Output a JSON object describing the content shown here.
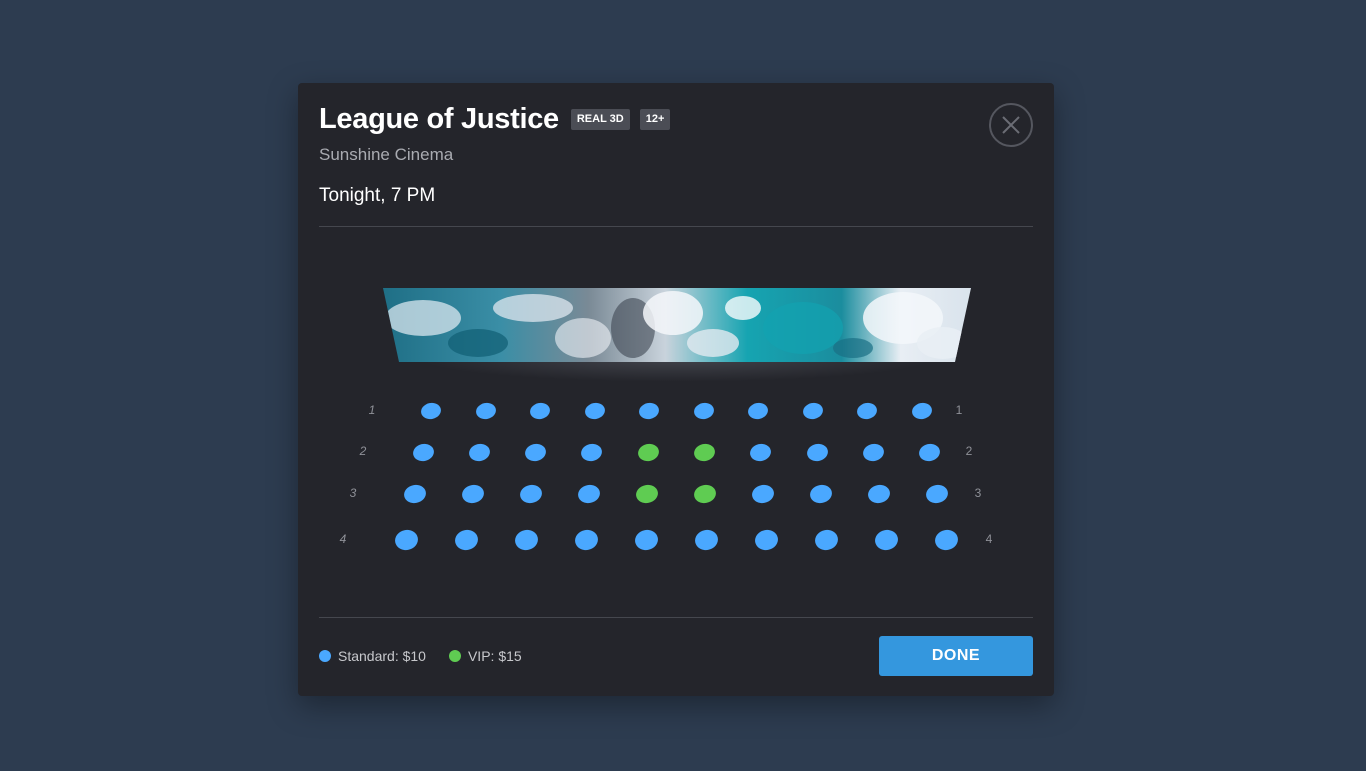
{
  "movie": {
    "title": "League of Justice",
    "badges": [
      "REAL 3D",
      "12+"
    ],
    "cinema": "Sunshine Cinema",
    "showtime": "Tonight, 7 PM"
  },
  "close_icon": "close-icon",
  "screen": {
    "image": "ocean-waves-aerial-photo"
  },
  "seating": {
    "rows": [
      {
        "label": "1",
        "seats": [
          "standard",
          "standard",
          "standard",
          "standard",
          "standard",
          "standard",
          "standard",
          "standard",
          "standard",
          "standard"
        ]
      },
      {
        "label": "2",
        "seats": [
          "standard",
          "standard",
          "standard",
          "standard",
          "vip",
          "vip",
          "standard",
          "standard",
          "standard",
          "standard"
        ]
      },
      {
        "label": "3",
        "seats": [
          "standard",
          "standard",
          "standard",
          "standard",
          "vip",
          "vip",
          "standard",
          "standard",
          "standard",
          "standard"
        ]
      },
      {
        "label": "4",
        "seats": [
          "standard",
          "standard",
          "standard",
          "standard",
          "standard",
          "standard",
          "standard",
          "standard",
          "standard",
          "standard"
        ]
      }
    ]
  },
  "colors": {
    "standard": "#4aa8ff",
    "vip": "#5fcc52",
    "accent": "#3497de",
    "background": "#2d3c50",
    "modal": "#24252b"
  },
  "legend": [
    {
      "type": "standard",
      "label": "Standard: $10"
    },
    {
      "type": "vip",
      "label": "VIP: $15"
    }
  ],
  "done_label": "DONE"
}
